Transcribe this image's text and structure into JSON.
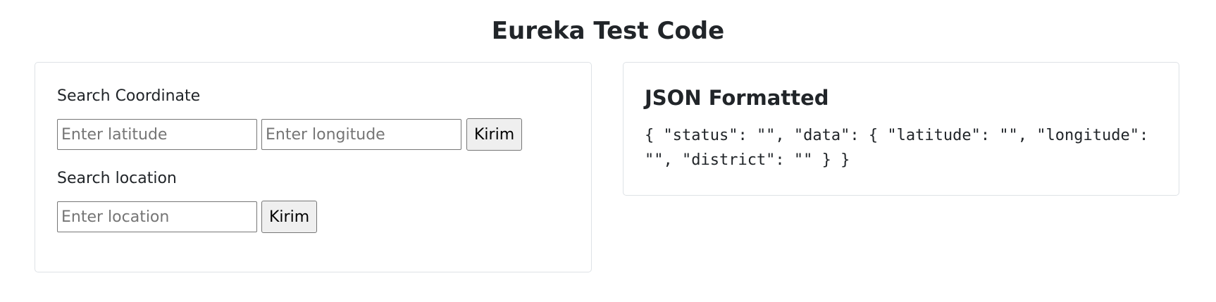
{
  "page": {
    "title": "Eureka Test Code"
  },
  "coordinate_search": {
    "label": "Search Coordinate",
    "latitude_placeholder": "Enter latitude",
    "latitude_value": "",
    "longitude_placeholder": "Enter longitude",
    "longitude_value": "",
    "submit_label": "Kirim"
  },
  "location_search": {
    "label": "Search location",
    "location_placeholder": "Enter location",
    "location_value": "",
    "submit_label": "Kirim"
  },
  "json_panel": {
    "title": "JSON Formatted",
    "content": "{ \"status\": \"\", \"data\": { \"latitude\": \"\", \"longitude\": \"\", \"district\": \"\" } }"
  }
}
